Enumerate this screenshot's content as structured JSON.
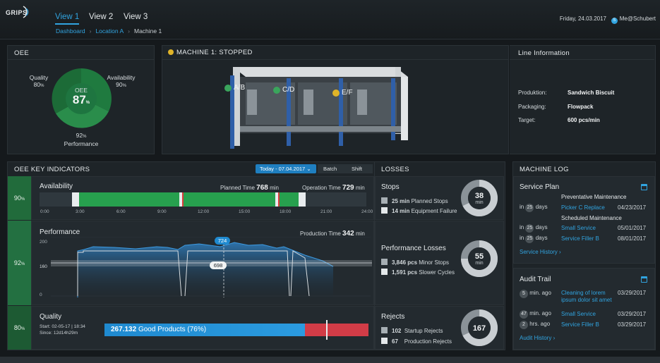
{
  "header": {
    "logo_text": "GRIPS",
    "tabs": [
      "View 1",
      "View 2",
      "View 3"
    ],
    "breadcrumb": [
      "Dashboard",
      "Location A",
      "Machine 1"
    ],
    "date": "Friday, 24.03.2017",
    "user_initial": "S",
    "user": "Me@Schubert"
  },
  "oee": {
    "title": "OEE",
    "center_label": "OEE",
    "center_value": "87",
    "quality_label": "Quality",
    "quality_value": "80",
    "availability_label": "Availability",
    "availability_value": "90",
    "performance_label": "Performance",
    "performance_value": "92",
    "pct": "%",
    "colors": {
      "ring": "#217a3f",
      "ring_light": "#2a8f4c",
      "center": "#1e6e39"
    }
  },
  "machine": {
    "title": "MACHINE 1: STOPPED",
    "status_color": "#e0b428",
    "stations": [
      {
        "label": "A/B",
        "color": "#3aa55c"
      },
      {
        "label": "C/D",
        "color": "#3aa55c"
      },
      {
        "label": "E/F",
        "color": "#e0b428"
      }
    ]
  },
  "line_info": {
    "title": "Line Information",
    "rows": [
      {
        "label": "Produktion:",
        "value": "Sandwich Biscuit"
      },
      {
        "label": "Packaging:",
        "value": "Flowpack"
      },
      {
        "label": "Target:",
        "value": "600 pcs/min"
      }
    ]
  },
  "kpi": {
    "title": "OEE KEY INDICATORS",
    "filter": "Today - 07.04.2017",
    "batch": "Batch",
    "shift": "Shift",
    "availability": {
      "side": "90",
      "label": "Availability",
      "planned_label": "Planned Time",
      "planned_value": "768",
      "operation_label": "Operation Time",
      "operation_value": "729",
      "unit": "min",
      "ticks": [
        "0:00",
        "3:00",
        "6:00",
        "9:00",
        "12:00",
        "15:00",
        "18:00",
        "21:00",
        "24:00"
      ]
    },
    "performance": {
      "side": "92",
      "label": "Performance",
      "production_label": "Production Time",
      "production_value": "342",
      "unit": "min",
      "y_top": "200",
      "y_mid": "160",
      "y_bottom": "0",
      "marker_top": "724",
      "marker_bottom": "698"
    },
    "quality": {
      "side": "80",
      "label": "Quality",
      "start": "Start: 02-05-17 | 18:34",
      "since": "Since: 12d14h29m",
      "good_value": "267.132",
      "good_label": "Good Products (76%)",
      "good_fraction": 0.76
    },
    "pct": "%"
  },
  "losses": {
    "title": "LOSSES",
    "stops": {
      "label": "Stops",
      "rows": [
        {
          "value": "25 min",
          "label": "Planned Stops"
        },
        {
          "value": "14 min",
          "label": "Equipment Failure"
        }
      ],
      "ring_value": "38",
      "ring_unit": "min"
    },
    "performance": {
      "label": "Performance Losses",
      "rows": [
        {
          "value": "3,846 pcs",
          "label": "Minor Stops"
        },
        {
          "value": "1,591 pcs",
          "label": "Slower Cycles"
        }
      ],
      "ring_value": "55",
      "ring_unit": "min"
    },
    "rejects": {
      "label": "Rejects",
      "rows": [
        {
          "value": "102",
          "label": "Startup Rejects"
        },
        {
          "value": "67",
          "label": "Production Rejects"
        }
      ],
      "ring_value": "167"
    }
  },
  "log": {
    "title": "MACHINE LOG",
    "service_plan": {
      "title": "Service Plan",
      "heading1": "Preventative Maintenance",
      "heading2": "Scheduled Maintenance",
      "rows": [
        {
          "in": "in",
          "num": "25",
          "unit": "days",
          "link": "Picker C Replace",
          "date": "04/23/2017"
        },
        {
          "in": "in",
          "num": "25",
          "unit": "days",
          "link": "Small Service",
          "date": "05/01/2017"
        },
        {
          "in": "in",
          "num": "25",
          "unit": "days",
          "link": "Service Filler B",
          "date": "08/01/2017"
        }
      ],
      "history": "Service History ›"
    },
    "audit": {
      "title": "Audit Trail",
      "rows": [
        {
          "num": "5",
          "unit": "min. ago",
          "link": "Cleaning of lorem ipsum dolor sit amet",
          "date": "03/29/2017"
        },
        {
          "num": "47",
          "unit": "min. ago",
          "link": "Small Service",
          "date": "03/29/2017"
        },
        {
          "num": "2",
          "unit": "hrs. ago",
          "link": "Service Filler B",
          "date": "03/29/2017"
        }
      ],
      "history": "Audit History ›"
    }
  }
}
